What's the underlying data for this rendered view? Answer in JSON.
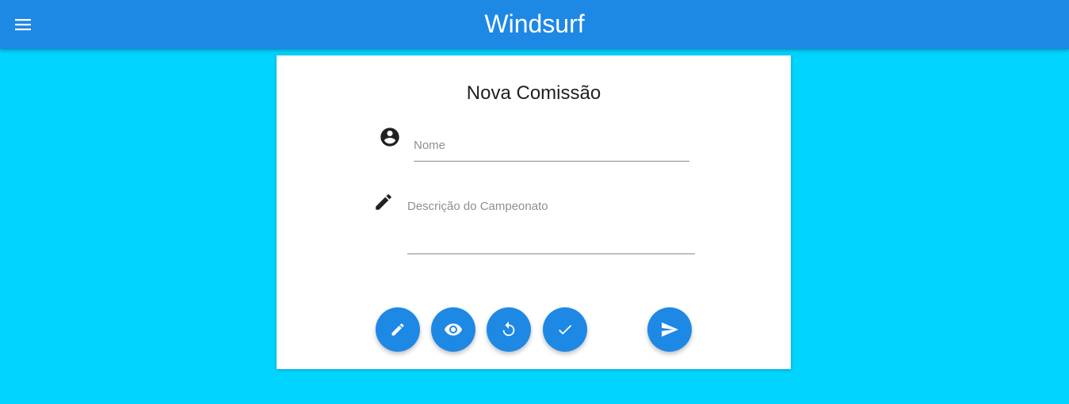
{
  "app": {
    "title": "Windsurf",
    "menu_icon": "menu-icon",
    "bar_color": "#1e88e5",
    "background_color": "#00d4ff"
  },
  "form": {
    "title": "Nova Comissão",
    "nome": {
      "icon": "account-circle-icon",
      "placeholder": "Nome",
      "value": ""
    },
    "descricao": {
      "icon": "pencil-icon",
      "placeholder": "Descrição do Campeonato",
      "value": ""
    }
  },
  "actions": [
    {
      "icon": "pencil-icon",
      "name": "edit"
    },
    {
      "icon": "eye-icon",
      "name": "view"
    },
    {
      "icon": "replay-icon",
      "name": "reset"
    },
    {
      "icon": "check-icon",
      "name": "confirm"
    },
    {
      "icon": "send-icon",
      "name": "send"
    }
  ],
  "accent_color": "#1e88e5"
}
